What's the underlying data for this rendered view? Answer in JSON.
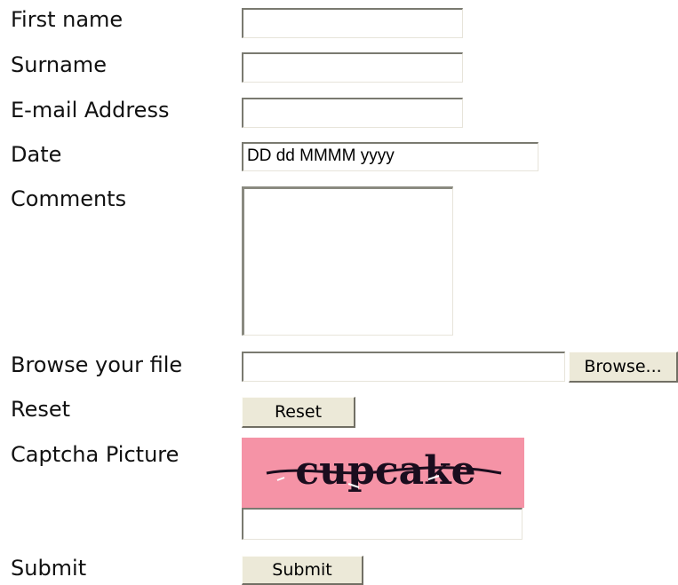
{
  "form": {
    "first_name": {
      "label": "First name",
      "value": ""
    },
    "surname": {
      "label": "Surname",
      "value": ""
    },
    "email": {
      "label": "E-mail Address",
      "value": ""
    },
    "date": {
      "label": "Date",
      "value": "DD dd MMMM yyyy"
    },
    "comments": {
      "label": "Comments",
      "value": ""
    },
    "file": {
      "label": "Browse your file",
      "value": "",
      "button": "Browse..."
    },
    "reset": {
      "label": "Reset",
      "button": "Reset"
    },
    "captcha": {
      "label": "Captcha Picture",
      "text": "cupcake",
      "background": "#f593a6",
      "value": ""
    },
    "submit": {
      "label": "Submit",
      "button": "Submit"
    }
  }
}
